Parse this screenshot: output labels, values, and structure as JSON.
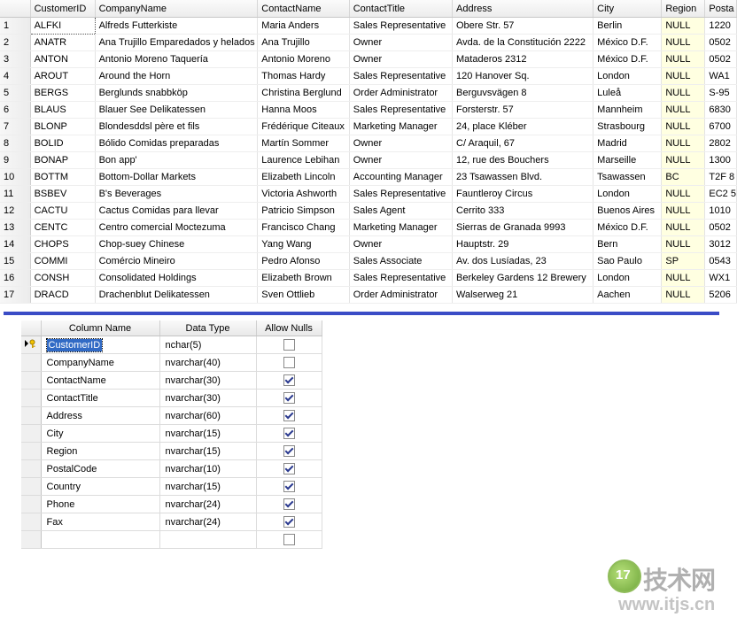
{
  "results": {
    "columns": [
      "",
      "CustomerID",
      "CompanyName",
      "ContactName",
      "ContactTitle",
      "Address",
      "City",
      "Region",
      "Posta"
    ],
    "rows": [
      [
        "1",
        "ALFKI",
        "Alfreds Futterkiste",
        "Maria Anders",
        "Sales Representative",
        "Obere Str. 57",
        "Berlin",
        "NULL",
        "1220"
      ],
      [
        "2",
        "ANATR",
        "Ana Trujillo Emparedados y helados",
        "Ana Trujillo",
        "Owner",
        "Avda. de la Constitución 2222",
        "México D.F.",
        "NULL",
        "0502"
      ],
      [
        "3",
        "ANTON",
        "Antonio Moreno Taquería",
        "Antonio Moreno",
        "Owner",
        "Mataderos  2312",
        "México D.F.",
        "NULL",
        "0502"
      ],
      [
        "4",
        "AROUT",
        "Around the Horn",
        "Thomas Hardy",
        "Sales Representative",
        "120 Hanover Sq.",
        "London",
        "NULL",
        "WA1"
      ],
      [
        "5",
        "BERGS",
        "Berglunds snabbköp",
        "Christina Berglund",
        "Order Administrator",
        "Berguvsvägen  8",
        "Luleå",
        "NULL",
        "S-95"
      ],
      [
        "6",
        "BLAUS",
        "Blauer See Delikatessen",
        "Hanna Moos",
        "Sales Representative",
        "Forsterstr. 57",
        "Mannheim",
        "NULL",
        "6830"
      ],
      [
        "7",
        "BLONP",
        "Blondesddsl père et fils",
        "Frédérique Citeaux",
        "Marketing Manager",
        "24, place Kléber",
        "Strasbourg",
        "NULL",
        "6700"
      ],
      [
        "8",
        "BOLID",
        "Bólido Comidas preparadas",
        "Martín Sommer",
        "Owner",
        "C/ Araquil, 67",
        "Madrid",
        "NULL",
        "2802"
      ],
      [
        "9",
        "BONAP",
        "Bon app'",
        "Laurence Lebihan",
        "Owner",
        "12, rue des Bouchers",
        "Marseille",
        "NULL",
        "1300"
      ],
      [
        "10",
        "BOTTM",
        "Bottom-Dollar Markets",
        "Elizabeth Lincoln",
        "Accounting Manager",
        "23 Tsawassen Blvd.",
        "Tsawassen",
        "BC",
        "T2F 8"
      ],
      [
        "11",
        "BSBEV",
        "B's Beverages",
        "Victoria Ashworth",
        "Sales Representative",
        "Fauntleroy Circus",
        "London",
        "NULL",
        "EC2 5"
      ],
      [
        "12",
        "CACTU",
        "Cactus Comidas para llevar",
        "Patricio Simpson",
        "Sales Agent",
        "Cerrito 333",
        "Buenos Aires",
        "NULL",
        "1010"
      ],
      [
        "13",
        "CENTC",
        "Centro comercial Moctezuma",
        "Francisco Chang",
        "Marketing Manager",
        "Sierras de Granada 9993",
        "México D.F.",
        "NULL",
        "0502"
      ],
      [
        "14",
        "CHOPS",
        "Chop-suey Chinese",
        "Yang Wang",
        "Owner",
        "Hauptstr. 29",
        "Bern",
        "NULL",
        "3012"
      ],
      [
        "15",
        "COMMI",
        "Comércio Mineiro",
        "Pedro Afonso",
        "Sales Associate",
        "Av. dos Lusíadas, 23",
        "Sao Paulo",
        "SP",
        "0543"
      ],
      [
        "16",
        "CONSH",
        "Consolidated Holdings",
        "Elizabeth Brown",
        "Sales Representative",
        "Berkeley Gardens 12  Brewery",
        "London",
        "NULL",
        "WX1"
      ],
      [
        "17",
        "DRACD",
        "Drachenblut Delikatessen",
        "Sven Ottlieb",
        "Order Administrator",
        "Walserweg 21",
        "Aachen",
        "NULL",
        "5206"
      ]
    ]
  },
  "designer": {
    "headers": [
      "",
      "Column Name",
      "Data Type",
      "Allow Nulls"
    ],
    "rows": [
      {
        "name": "CustomerID",
        "type": "nchar(5)",
        "nulls": false,
        "key": true
      },
      {
        "name": "CompanyName",
        "type": "nvarchar(40)",
        "nulls": false
      },
      {
        "name": "ContactName",
        "type": "nvarchar(30)",
        "nulls": true
      },
      {
        "name": "ContactTitle",
        "type": "nvarchar(30)",
        "nulls": true
      },
      {
        "name": "Address",
        "type": "nvarchar(60)",
        "nulls": true
      },
      {
        "name": "City",
        "type": "nvarchar(15)",
        "nulls": true
      },
      {
        "name": "Region",
        "type": "nvarchar(15)",
        "nulls": true
      },
      {
        "name": "PostalCode",
        "type": "nvarchar(10)",
        "nulls": true
      },
      {
        "name": "Country",
        "type": "nvarchar(15)",
        "nulls": true
      },
      {
        "name": "Phone",
        "type": "nvarchar(24)",
        "nulls": true
      },
      {
        "name": "Fax",
        "type": "nvarchar(24)",
        "nulls": true
      },
      {
        "name": "",
        "type": "",
        "nulls": false
      }
    ]
  },
  "watermark": {
    "logo_text": "17",
    "cn_text": "技术网",
    "url": "www.itjs.cn"
  }
}
